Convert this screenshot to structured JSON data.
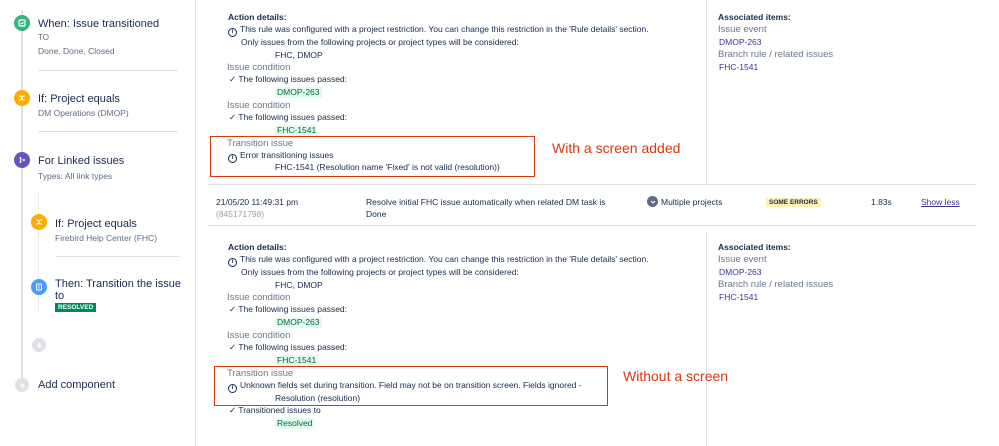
{
  "flow": {
    "nodes": [
      {
        "title": "When: Issue transitioned",
        "sub1": "TO",
        "sub2": "Done, Done, Closed"
      },
      {
        "title": "If: Project equals",
        "sub1": "DM Operations (DMOP)"
      },
      {
        "title": "For Linked issues",
        "sub1": "Types: All link types"
      },
      {
        "title": "If: Project equals",
        "sub1": "Firebird Help Center (FHC)"
      },
      {
        "title": "Then: Transition the issue",
        "title2": "to",
        "badge": "RESOLVED"
      }
    ],
    "add_component": "Add component"
  },
  "section1": {
    "action_details": "Action details:",
    "restriction_line1": "This rule was configured with a project restriction. You can change this restriction in the 'Rule details' section.",
    "restriction_line2": "Only issues from the following projects or project types will be considered:",
    "projects": "FHC, DMOP",
    "cond1_label": "Issue condition",
    "cond1_passed": "The following issues passed:",
    "cond1_issue": "DMOP-263",
    "cond2_label": "Issue condition",
    "cond2_passed": "The following issues passed:",
    "cond2_issue": "FHC-1541",
    "transition_label": "Transition issue",
    "transition_error": "Error transitioning issues",
    "transition_detail": "FHC-1541 (Resolution name 'Fixed' is not valid (resolution))",
    "assoc_title": "Associated items:",
    "assoc_event_label": "Issue event",
    "assoc_event_issue": "DMOP-263",
    "assoc_branch_label": "Branch rule / related issues",
    "assoc_branch_issue": "FHC-1541",
    "annotation": "With a screen added"
  },
  "audit_row": {
    "datetime": "21/05/20 11:49:31 pm",
    "id": "(845171798)",
    "summary_line1": "Resolve initial FHC issue automatically when related DM task is",
    "summary_line2": "Done",
    "scope": "Multiple projects",
    "status": "SOME ERRORS",
    "duration": "1.83s",
    "toggle": "Show less"
  },
  "section2": {
    "action_details": "Action details:",
    "restriction_line1": "This rule was configured with a project restriction. You can change this restriction in the 'Rule details' section.",
    "restriction_line2": "Only issues from the following projects or project types will be considered:",
    "projects": "FHC, DMOP",
    "cond1_label": "Issue condition",
    "cond1_passed": "The following issues passed:",
    "cond1_issue": "DMOP-263",
    "cond2_label": "Issue condition",
    "cond2_passed": "The following issues passed:",
    "cond2_issue": "FHC-1541",
    "transition_label": "Transition issue",
    "transition_warn1": "Unknown fields set during transition. Field may not be on transition screen. Fields ignored -",
    "transition_warn2": "Resolution (resolution)",
    "transitioned": "Transitioned issues to",
    "transitioned_value": "Resolved",
    "assoc_title": "Associated items:",
    "assoc_event_label": "Issue event",
    "assoc_event_issue": "DMOP-263",
    "assoc_branch_label": "Branch rule / related issues",
    "assoc_branch_issue": "FHC-1541",
    "annotation": "Without a screen"
  },
  "colors": {
    "trigger": "#36b37e",
    "condition": "#ffab00",
    "branch": "#6554c0",
    "action": "#4c9aff",
    "annotation": "#de350b"
  }
}
